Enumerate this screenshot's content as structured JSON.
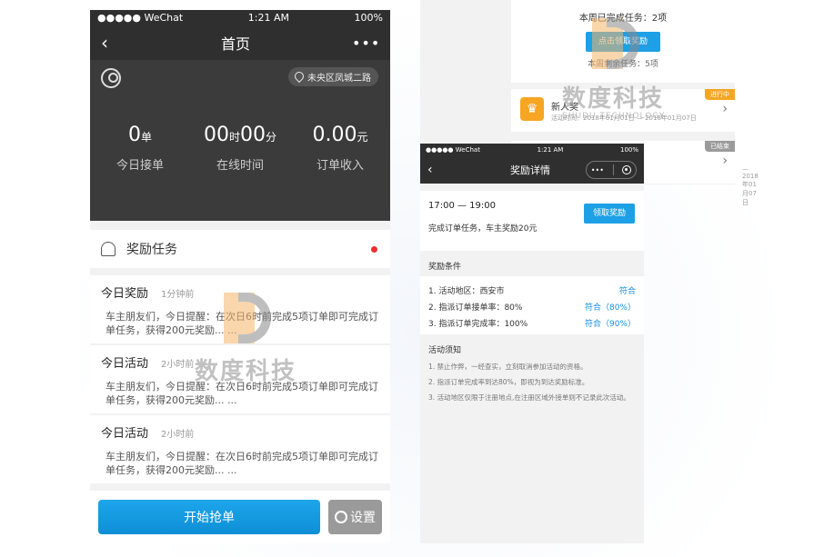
{
  "left_phone": {
    "status": {
      "carrier": "●●●●● WeChat",
      "time": "1:21 AM",
      "battery": "100%"
    },
    "nav": {
      "title": "首页",
      "back_icon": "chevron-left-icon",
      "more_icon": "more-dots-icon"
    },
    "location": "未央区凤城二路",
    "stats": [
      {
        "value": "0",
        "unit": "单",
        "label": "今日接单"
      },
      {
        "value_a": "00",
        "unit_a": "时",
        "value_b": "00",
        "unit_b": "分",
        "label": "在线时间"
      },
      {
        "value": "0.00",
        "unit": "元",
        "label": "订单收入"
      }
    ],
    "task_label": "奖励任务",
    "messages": [
      {
        "title": "今日奖励",
        "time": "1分钟前",
        "body": "车主朋友们，今日提醒：在次日6时前完成5项订单即可完成订单任务，获得200元奖励... ..."
      },
      {
        "title": "今日活动",
        "time": "2小时前",
        "body": "车主朋友们，今日提醒：在次日6时前完成5项订单即可完成订单任务，获得200元奖励... ..."
      },
      {
        "title": "今日活动",
        "time": "2小时前",
        "body": "车主朋友们，今日提醒：在次日6时前完成5项订单即可完成订单任务，获得200元奖励... ..."
      }
    ],
    "grab_button": "开始抢单",
    "settings_button": "设置"
  },
  "right_top": {
    "completed": "本周已完成任务：2项",
    "claim_button": "点击领取奖励",
    "remaining": "本周剩余任务：5项",
    "rows": [
      {
        "name": "新人奖",
        "sub": "活动时间：2018年01月01日 — 2018年01月07日",
        "badge": "进行中",
        "badge_color": "#f5a623"
      },
      {
        "name": "",
        "sub": "— 2018年01月07日",
        "badge": "已结束",
        "badge_color": "#9b9b9b"
      }
    ]
  },
  "right_phone": {
    "status": {
      "carrier": "●●●●● WeChat",
      "time": "1:21 AM",
      "battery": "100%"
    },
    "nav": {
      "title": "奖励详情"
    },
    "time_range": "17:00 — 19:00",
    "claim_button": "领取奖励",
    "desc": "完成订单任务，车主奖励20元",
    "conditions_title": "奖励条件",
    "conditions": [
      {
        "text": "1. 活动地区：西安市",
        "status": "符合"
      },
      {
        "text": "2. 指派订单接单率：80%",
        "status": "符合（80%）"
      },
      {
        "text": "3. 指派订单完成率：100%",
        "status": "符合（90%）"
      }
    ],
    "notes_title": "活动须知",
    "notes": [
      "1. 禁止作弊，一经查实，立刻取消参加活动的资格。",
      "2. 指派订单完成率到达80%，即视为到达奖励标准。",
      "3. 活动地区仅限于注册地点,在注册区域外接单则不记录此次活动。"
    ]
  },
  "watermark": {
    "cn": "数度科技",
    "en": "SHUDU TECHNOLOGY"
  },
  "colors": {
    "accent": "#1ea0e6",
    "dark": "#2f2f2f",
    "orange": "#f5a623"
  }
}
